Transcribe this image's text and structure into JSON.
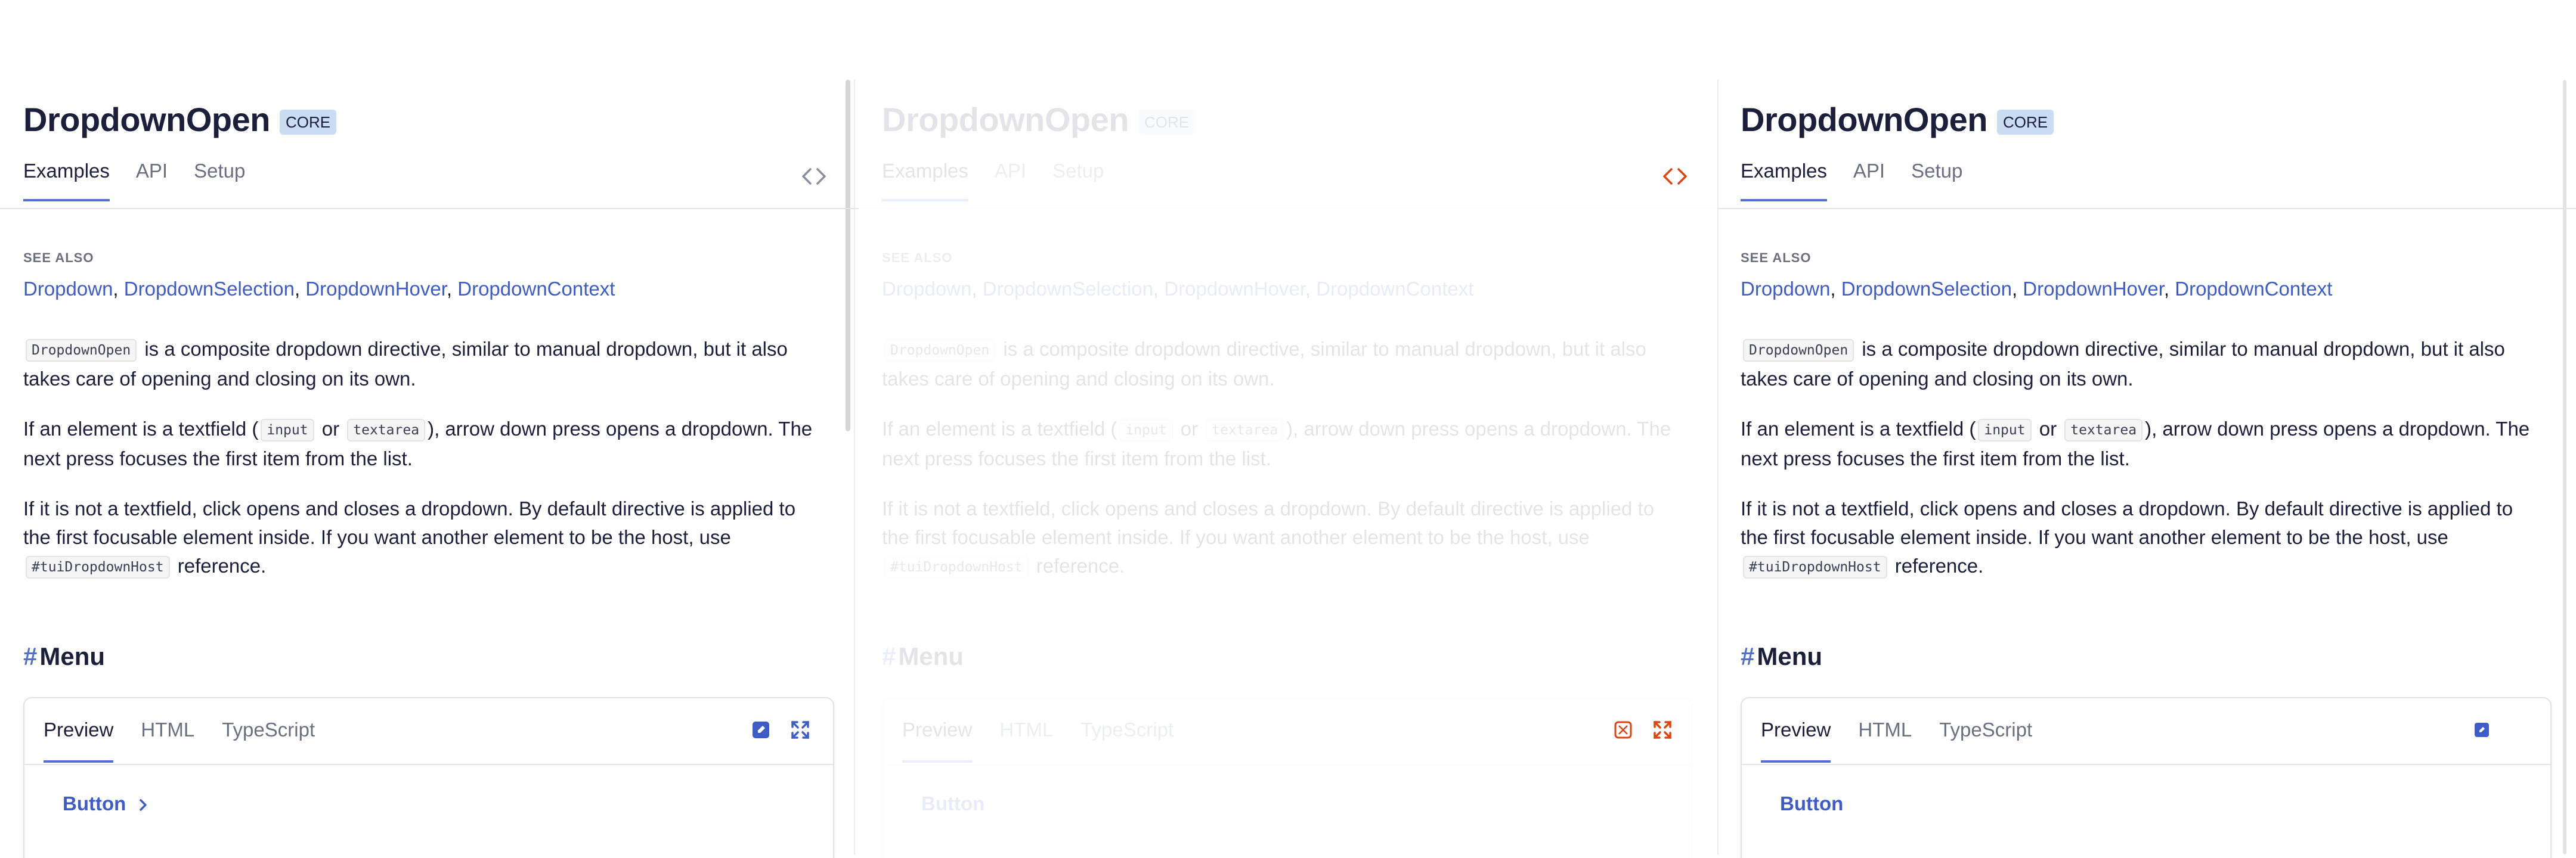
{
  "page": {
    "title": "DropdownOpen",
    "badge": "CORE",
    "tabs": [
      "Examples",
      "API",
      "Setup"
    ]
  },
  "see_also": {
    "label": "SEE ALSO",
    "links": [
      "Dropdown",
      "DropdownSelection",
      "DropdownHover",
      "DropdownContext"
    ],
    "separator": ", "
  },
  "paragraphs": {
    "p1_code": "DropdownOpen",
    "p1_text": " is a composite dropdown directive, similar to manual dropdown, but it also takes care of opening and closing on its own.",
    "p2_start": "If an element is a textfield (",
    "p2_code1": "input",
    "p2_or": " or ",
    "p2_code2": "textarea",
    "p2_end": "), arrow down press opens a dropdown. The next press focuses the first item from the list.",
    "p3_start": "If it is not a textfield, click opens and closes a dropdown. By default directive is applied to the first focusable element inside. If you want another element to be the host, use",
    "p3_code": "#tuiDropdownHost",
    "p3_end": " reference."
  },
  "section": {
    "hash": "#",
    "title": "Menu"
  },
  "demo": {
    "tabs": [
      "Preview",
      "HTML",
      "TypeScript"
    ],
    "button_label": "Button"
  },
  "icons": {
    "code": "code-brackets-icon",
    "stackblitz": "edit-sandbox-icon",
    "fullscreen": "fullscreen-icon",
    "chevron": "chevron-right-icon"
  },
  "colors": {
    "accent": "#526ed3",
    "link": "#3d5cc9",
    "badge_bg": "#c9dcf4",
    "highlight": "#e0440e",
    "text": "#1b1f3b",
    "muted": "#6b7080"
  }
}
